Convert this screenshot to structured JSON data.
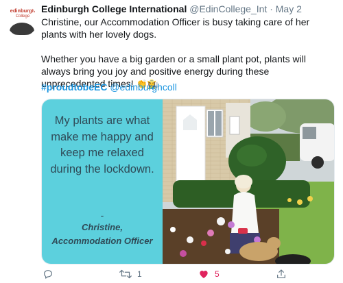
{
  "tweet": {
    "avatar_brand_line1": "edinburgh",
    "avatar_brand_line2": "College",
    "author_name": "Edinburgh College International",
    "author_handle": "@EdinCollege_Int",
    "separator": "·",
    "date": "May 2",
    "paragraph1": "Christine, our Accommodation Officer is busy taking care of her plants with her lovely dogs.",
    "paragraph2": "Whether you have a big garden or a small plant pot, plants will always bring you joy and positive energy during these unprecedented times!",
    "emoji": "👏👩‍🌾",
    "hashtag": "#proudtobeEC",
    "mention": "@edinburghcoll",
    "card": {
      "quote": "My plants are what make me happy and keep me relaxed during the lockdown.",
      "dash": "-",
      "attribution": "Christine, Accommodation Officer"
    },
    "actions": {
      "reply_count": "",
      "retweet_count": "1",
      "like_count": "5",
      "liked": true
    }
  },
  "colors": {
    "accent": "#1b95e0",
    "like": "#e0245e",
    "muted": "#657786",
    "card_panel": "#5cd0dd"
  },
  "icons": [
    "reply-icon",
    "retweet-icon",
    "heart-icon",
    "share-icon"
  ]
}
